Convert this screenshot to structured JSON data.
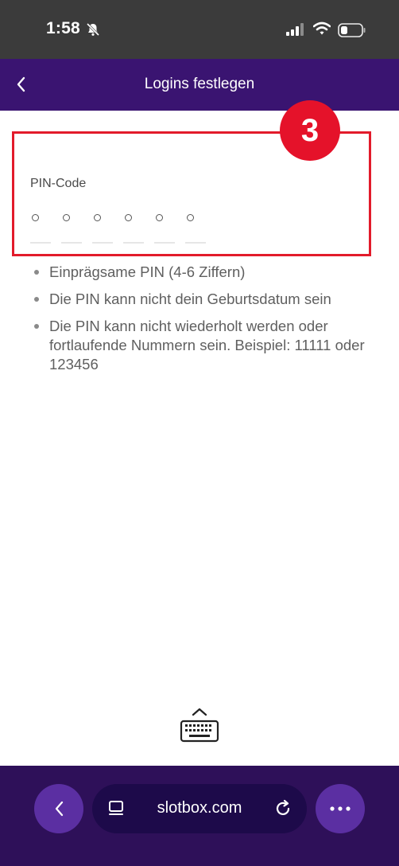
{
  "status_bar": {
    "time": "1:58"
  },
  "header": {
    "title": "Logins festlegen"
  },
  "step_badge": "3",
  "pin": {
    "label": "PIN-Code",
    "digit_count": 6,
    "filled": 0
  },
  "rules": [
    "Einprägsame PIN (4-6 Ziffern)",
    "Die PIN kann nicht dein Geburtsdatum sein",
    "Die PIN kann nicht wiederholt werden oder fortlaufende Nummern sein. Beispiel: 11111 oder 123456"
  ],
  "browser": {
    "url": "slotbox.com"
  },
  "colors": {
    "header_bg": "#3a1471",
    "highlight": "#e21b2b",
    "browser_bg": "#2e1059",
    "button_bg": "#5b2fa2"
  },
  "icons": [
    "bell-slash-icon",
    "signal-icon",
    "wifi-icon",
    "battery-icon",
    "chevron-left-icon",
    "keyboard-icon",
    "tabs-icon",
    "reload-icon",
    "more-icon"
  ]
}
